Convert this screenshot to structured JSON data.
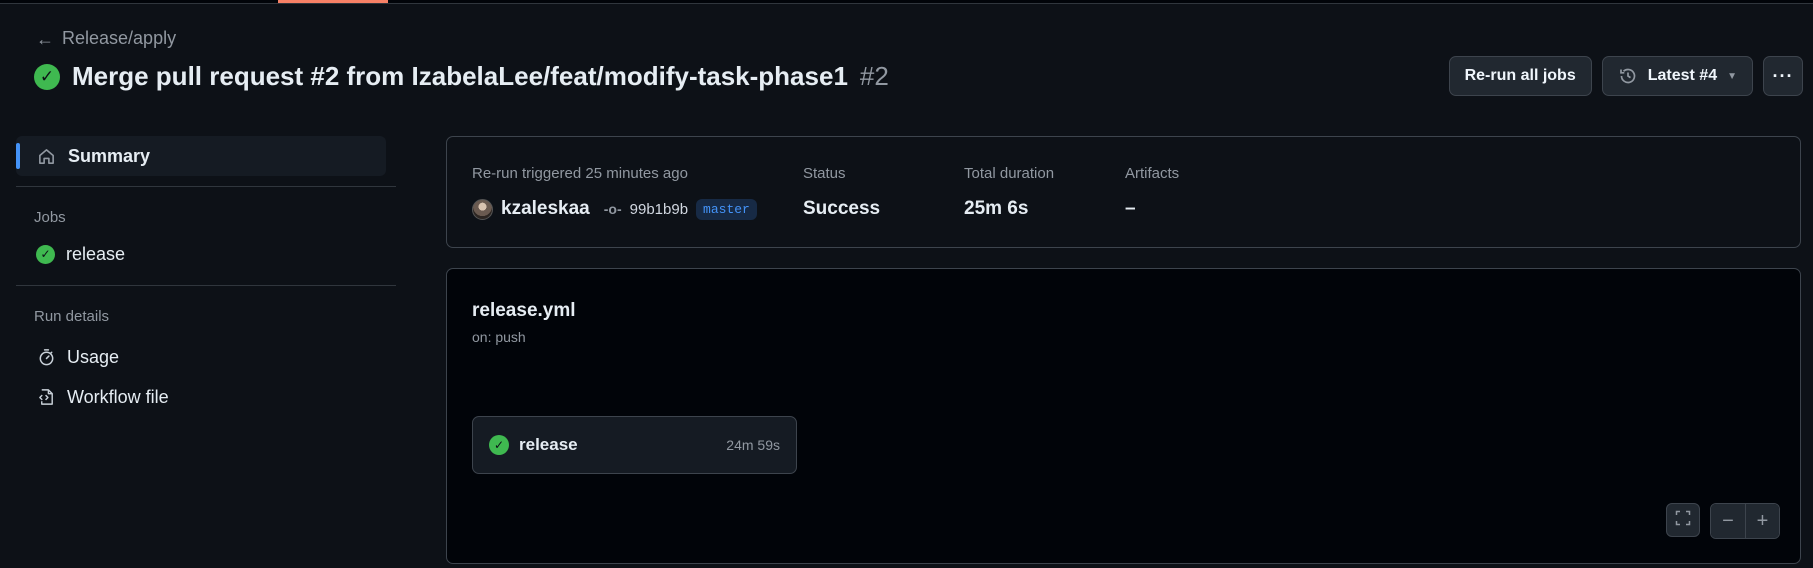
{
  "header": {
    "back_label": "Release/apply",
    "title": "Merge pull request #2 from IzabelaLee/feat/modify-task-phase1",
    "run_number": "#2",
    "status_color": "#3fb950",
    "actions": {
      "rerun_label": "Re-run all jobs",
      "attempt_label": "Latest #4",
      "more_label": "···"
    }
  },
  "sidebar": {
    "summary_label": "Summary",
    "jobs_section_label": "Jobs",
    "jobs": [
      {
        "label": "release",
        "status": "success"
      }
    ],
    "run_details_label": "Run details",
    "run_details": [
      {
        "label": "Usage",
        "icon": "stopwatch-icon"
      },
      {
        "label": "Workflow file",
        "icon": "file-code-icon"
      }
    ]
  },
  "summary": {
    "trigger_label": "Re-run triggered 25 minutes ago",
    "actor": "kzaleskaa",
    "commit_sha": "99b1b9b",
    "branch": "master",
    "status_label": "Status",
    "status_value": "Success",
    "duration_label": "Total duration",
    "duration_value": "25m 6s",
    "artifacts_label": "Artifacts",
    "artifacts_value": "–"
  },
  "graph": {
    "workflow_name": "release.yml",
    "trigger": "on: push",
    "jobs": [
      {
        "name": "release",
        "duration": "24m 59s",
        "status": "success"
      }
    ]
  },
  "colors": {
    "accent": "#4493f8",
    "success": "#3fb950",
    "tab_marker": "#f78166"
  }
}
